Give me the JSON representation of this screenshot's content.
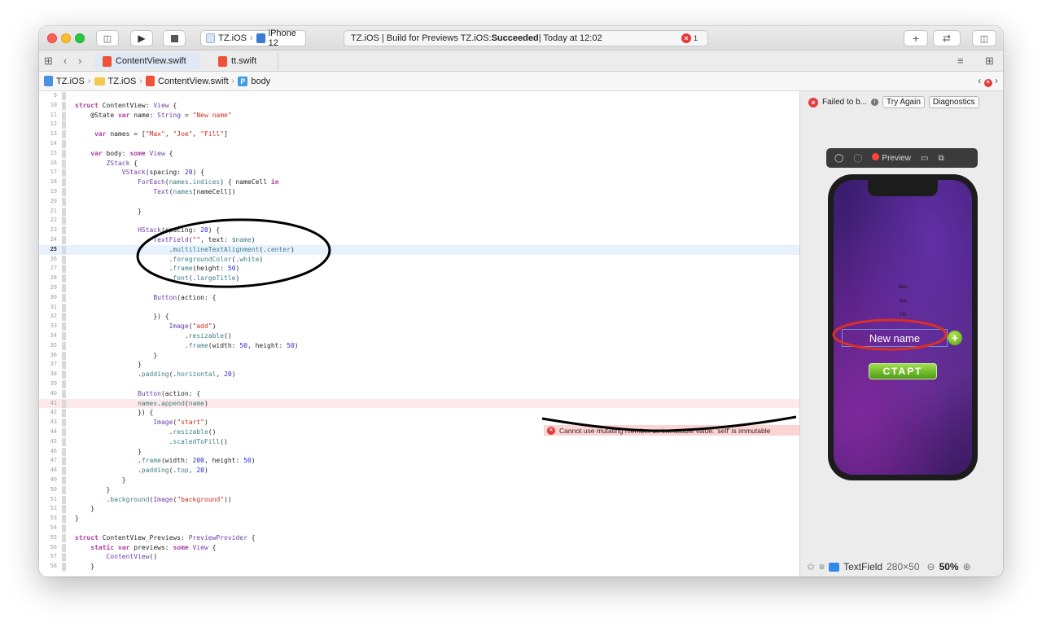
{
  "toolbar": {
    "scheme_project": "TZ.iOS",
    "scheme_device": "iPhone 12",
    "activity_prefix": "TZ.iOS | Build for Previews TZ.iOS: ",
    "activity_status": "Succeeded",
    "activity_time": " | Today at 12:02",
    "error_count": "1",
    "add_label": "+",
    "swap_label": "⇄"
  },
  "tabs": [
    {
      "label": "ContentView.swift",
      "active": true
    },
    {
      "label": "tt.swift",
      "active": false
    }
  ],
  "jumpbar": {
    "items": [
      "TZ.iOS",
      "TZ.iOS",
      "ContentView.swift",
      "body"
    ]
  },
  "code_lines": [
    {
      "num": "9",
      "html": ""
    },
    {
      "num": "10",
      "html": "<span class='kw'>struct</span> ContentView: <span class='ty'>View</span> {"
    },
    {
      "num": "11",
      "html": "    @State <span class='kw'>var</span> name: <span class='ty'>String</span> = <span class='st'>\"New name\"</span>"
    },
    {
      "num": "12",
      "html": ""
    },
    {
      "num": "13",
      "html": "     <span class='kw'>var</span> names = [<span class='st'>\"Max\"</span>, <span class='st'>\"Joe\"</span>, <span class='st'>\"Fill\"</span>]"
    },
    {
      "num": "14",
      "html": ""
    },
    {
      "num": "15",
      "html": "    <span class='kw'>var</span> body: <span class='kw'>some</span> <span class='ty'>View</span> {"
    },
    {
      "num": "16",
      "html": "        <span class='ty'>ZStack</span> {"
    },
    {
      "num": "17",
      "html": "            <span class='ty'>VStack</span>(spacing: <span class='nu'>20</span>) {"
    },
    {
      "num": "18",
      "html": "                <span class='ty'>ForEach</span>(<span class='fn'>names</span>.<span class='fn'>indices</span>) { nameCell <span class='kw'>in</span>"
    },
    {
      "num": "19",
      "html": "                    <span class='ty'>Text</span>(<span class='fn'>names</span>[nameCell])"
    },
    {
      "num": "20",
      "html": ""
    },
    {
      "num": "21",
      "html": "                }"
    },
    {
      "num": "22",
      "html": ""
    },
    {
      "num": "23",
      "html": "                <span class='ty'>HStack</span>(spacing: <span class='nu'>20</span>) {"
    },
    {
      "num": "24",
      "html": "                    <span class='ty'>TextField</span>(<span class='st'>\"\"</span>, text: <span class='fn'>$name</span>)"
    },
    {
      "num": "25",
      "html": "                        .<span class='fn'>multilineTextAlignment</span>(.<span class='fn'>center</span>)"
    },
    {
      "num": "26",
      "html": "                        .<span class='fn'>foregroundColor</span>(.<span class='fn'>white</span>)"
    },
    {
      "num": "27",
      "html": "                        .<span class='fn'>frame</span>(height: <span class='nu'>50</span>)"
    },
    {
      "num": "28",
      "html": "                        .<span class='fn'>font</span>(.<span class='fn'>largeTitle</span>)"
    },
    {
      "num": "29",
      "html": ""
    },
    {
      "num": "30",
      "html": "                    <span class='ty'>Button</span>(action: {"
    },
    {
      "num": "31",
      "html": ""
    },
    {
      "num": "32",
      "html": "                    }) {"
    },
    {
      "num": "33",
      "html": "                        <span class='ty'>Image</span>(<span class='st'>\"add\"</span>)"
    },
    {
      "num": "34",
      "html": "                            .<span class='fn'>resizable</span>()"
    },
    {
      "num": "35",
      "html": "                            .<span class='fn'>frame</span>(width: <span class='nu'>50</span>, height: <span class='nu'>50</span>)"
    },
    {
      "num": "36",
      "html": "                    }"
    },
    {
      "num": "37",
      "html": "                }"
    },
    {
      "num": "38",
      "html": "                .<span class='fn'>padding</span>(.<span class='fn'>horizontal</span>, <span class='nu'>20</span>)"
    },
    {
      "num": "39",
      "html": ""
    },
    {
      "num": "40",
      "html": "                <span class='ty'>Button</span>(action: {"
    },
    {
      "num": "41",
      "html": "                <span class='fn'>names</span>.<span class='fn'>append</span>(<span class='fn'>name</span>)"
    },
    {
      "num": "42",
      "html": "                }) {"
    },
    {
      "num": "43",
      "html": "                    <span class='ty'>Image</span>(<span class='st'>\"start\"</span>)"
    },
    {
      "num": "44",
      "html": "                        .<span class='fn'>resizable</span>()"
    },
    {
      "num": "45",
      "html": "                        .<span class='fn'>scaledToFill</span>()"
    },
    {
      "num": "46",
      "html": "                }"
    },
    {
      "num": "47",
      "html": "                .<span class='fn'>frame</span>(width: <span class='nu'>200</span>, height: <span class='nu'>50</span>)"
    },
    {
      "num": "48",
      "html": "                .<span class='fn'>padding</span>(.<span class='fn'>top</span>, <span class='nu'>20</span>)"
    },
    {
      "num": "49",
      "html": "            }"
    },
    {
      "num": "50",
      "html": "        }"
    },
    {
      "num": "51",
      "html": "        .<span class='fn'>background</span>(<span class='ty'>Image</span>(<span class='st'>\"background\"</span>))"
    },
    {
      "num": "52",
      "html": "    }"
    },
    {
      "num": "53",
      "html": "}"
    },
    {
      "num": "54",
      "html": ""
    },
    {
      "num": "55",
      "html": "<span class='kw'>struct</span> ContentView_Previews: <span class='ty'>PreviewProvider</span> {"
    },
    {
      "num": "56",
      "html": "    <span class='kw'>static</span> <span class='kw'>var</span> previews: <span class='kw'>some</span> <span class='ty'>View</span> {"
    },
    {
      "num": "57",
      "html": "        <span class='ty'>ContentView</span>()"
    },
    {
      "num": "58",
      "html": "    }"
    }
  ],
  "current_line": "25",
  "error_line": "41",
  "error_message": "Cannot use mutating member on immutable value: 'self' is immutable",
  "canvas": {
    "status": "Failed to b...",
    "try_again": "Try Again",
    "diagnostics": "Diagnostics",
    "preview_label": "Preview",
    "names": [
      "Max",
      "Joe",
      "Fill"
    ],
    "textfield_value": "New name",
    "start_label": "СТАРТ",
    "selected_element": "TextField",
    "selected_size": "280×50",
    "zoom": "50%"
  },
  "colors": {
    "error": "#e5393b",
    "annotation_red": "#d93025",
    "annotation_black": "#000000"
  }
}
